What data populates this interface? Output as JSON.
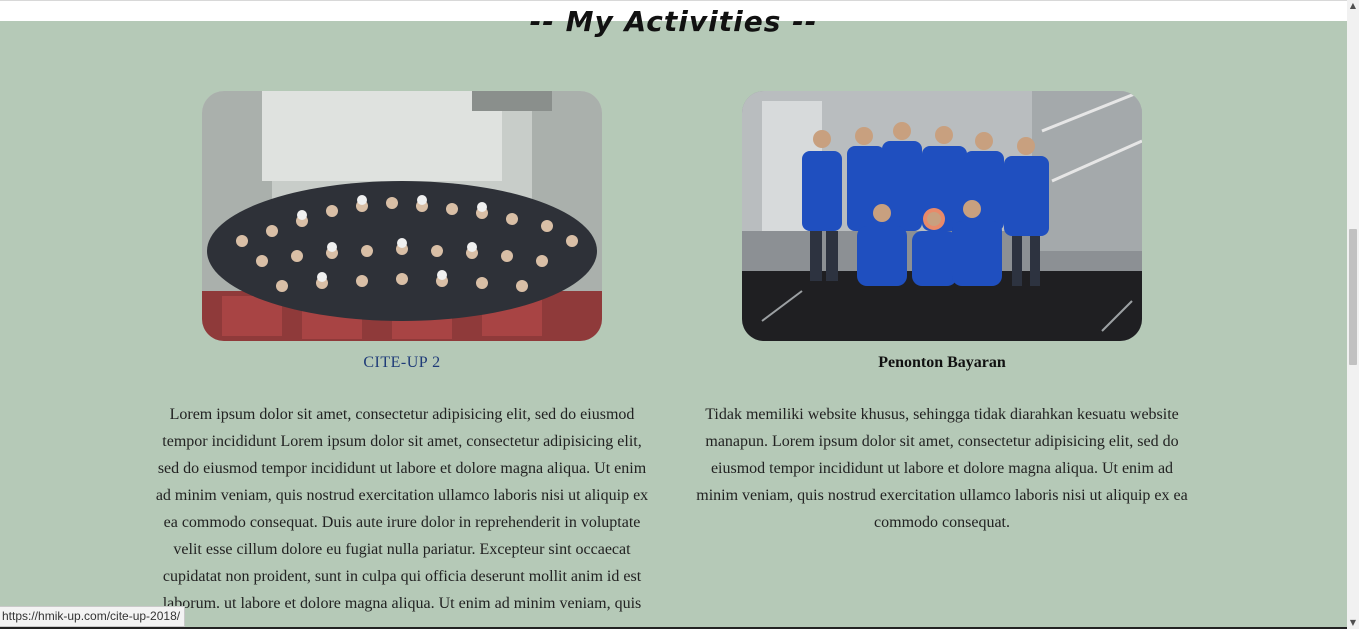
{
  "section": {
    "title": "-- My Activities --"
  },
  "activities": [
    {
      "caption": "CITE-UP 2",
      "description": "Lorem ipsum dolor sit amet, consectetur adipisicing elit, sed do eiusmod tempor incididunt Lorem ipsum dolor sit amet, consectetur adipisicing elit, sed do eiusmod tempor incididunt ut labore et dolore magna aliqua. Ut enim ad minim veniam, quis nostrud exercitation ullamco laboris nisi ut aliquip ex ea commodo consequat. Duis aute irure dolor in reprehenderit in voluptate velit esse cillum dolore eu fugiat nulla pariatur. Excepteur sint occaecat cupidatat non proident, sunt in culpa qui officia deserunt mollit anim id est laborum. ut labore et dolore magna aliqua. Ut enim ad minim veniam, quis"
    },
    {
      "caption": "Penonton Bayaran",
      "description": "Tidak memiliki website khusus, sehingga tidak diarahkan kesuatu website manapun. Lorem ipsum dolor sit amet, consectetur adipisicing elit, sed do eiusmod tempor incididunt ut labore et dolore magna aliqua. Ut enim ad minim veniam, quis nostrud exercitation ullamco laboris nisi ut aliquip ex ea commodo consequat."
    }
  ],
  "status_bar": {
    "url": "https://hmik-up.com/cite-up-2018/"
  },
  "colors": {
    "background": "#b5c9b7",
    "link": "#1f3b78"
  }
}
